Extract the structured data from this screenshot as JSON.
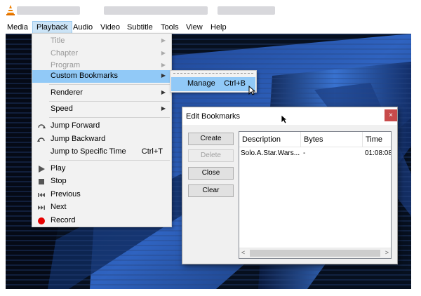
{
  "menubar": {
    "items": [
      {
        "label": "Media"
      },
      {
        "label": "Playback"
      },
      {
        "label": "Audio"
      },
      {
        "label": "Video"
      },
      {
        "label": "Subtitle"
      },
      {
        "label": "Tools"
      },
      {
        "label": "View"
      },
      {
        "label": "Help"
      }
    ]
  },
  "playback_menu": {
    "title": "Title",
    "chapter": "Chapter",
    "program": "Program",
    "custom_bookmarks": "Custom Bookmarks",
    "renderer": "Renderer",
    "speed": "Speed",
    "jump_forward": "Jump Forward",
    "jump_backward": "Jump Backward",
    "jump_specific": "Jump to Specific Time",
    "jump_specific_shortcut": "Ctrl+T",
    "play": "Play",
    "stop": "Stop",
    "previous": "Previous",
    "next": "Next",
    "record": "Record",
    "arrow": "▶"
  },
  "submenu": {
    "manage": "Manage",
    "manage_shortcut": "Ctrl+B"
  },
  "dialog": {
    "title": "Edit Bookmarks",
    "close": "×",
    "buttons": {
      "create": "Create",
      "delete": "Delete",
      "close": "Close",
      "clear": "Clear"
    },
    "columns": {
      "description": "Description",
      "bytes": "Bytes",
      "time": "Time"
    },
    "rows": [
      {
        "description": "Solo.A.Star.Wars...",
        "bytes": "-",
        "time": "01:08:08"
      }
    ],
    "scroll_left": "<",
    "scroll_right": ">"
  },
  "colors": {
    "menu_highlight": "#91c9f7",
    "menubar_active": "#cce4f7",
    "close_button": "#c84b4b",
    "record_icon": "#e60000"
  }
}
